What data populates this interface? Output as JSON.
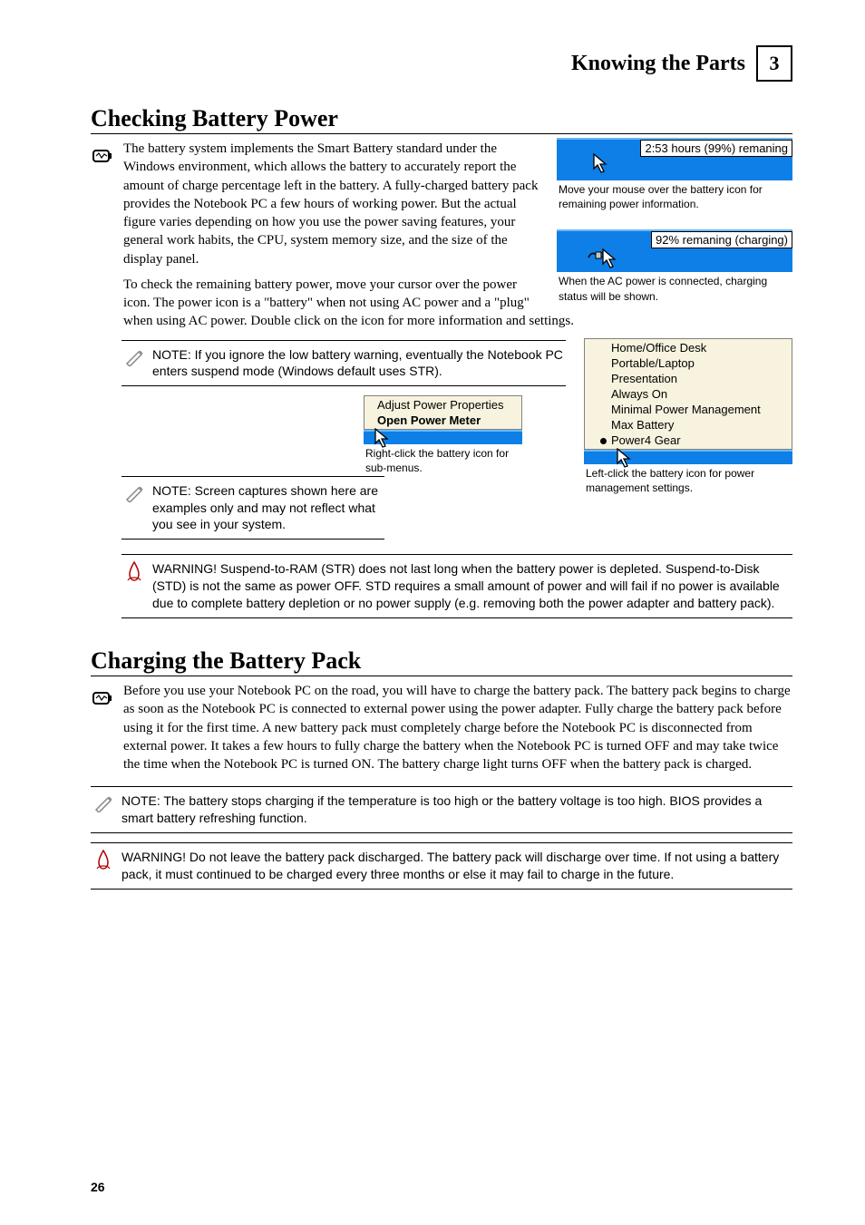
{
  "header": {
    "title": "Knowing the Parts",
    "num": "3"
  },
  "section1_title": "Checking Battery Power",
  "icon1_glyph": "~",
  "body1": "The battery system implements the Smart Battery standard under the Windows environment, which allows the battery to accurately report the amount of charge percentage left in the battery. A fully-charged battery pack provides the Notebook PC a few hours of working power. But the actual figure varies depending on how you use the power saving features, your general work habits, the CPU, system memory size, and the size of the display panel.",
  "body1_tail": "To check the remaining battery power, move your cursor over the power icon. The power icon is a \"battery\" when not using AC power and a \"plug\" when using AC power. Double click on the icon for more information and settings.",
  "tooltip1": "2:53 hours (99%) remaning",
  "cap1": "Move your mouse over the battery icon for remaining power information.",
  "tooltip2": "92% remaning (charging)",
  "cap2": "When the AC power is connected, charging status will be shown.",
  "note1": "NOTE: If you ignore the low battery warning, eventually the Notebook PC enters suspend mode (Windows default uses STR).",
  "note2": "NOTE: Screen captures shown here are examples only and may not reflect what you see in your system.",
  "menu1": {
    "items": [
      "Adjust Power Properties",
      "Open Power Meter"
    ]
  },
  "cap3": "Right-click the battery icon for sub-menus.",
  "menu2": {
    "items": [
      "Home/Office Desk",
      "Portable/Laptop",
      "Presentation",
      "Always On",
      "Minimal Power Management",
      "Max Battery",
      "Power4 Gear"
    ],
    "selected_index": 6
  },
  "cap4": "Left-click the battery icon for power management settings.",
  "warn1": "WARNING! Suspend-to-RAM (STR) does not last long when the battery power is depleted. Suspend-to-Disk (STD) is not the same as power OFF. STD requires a small amount of power and will fail if no power is available due to complete battery depletion or no power supply (e.g. removing both the power adapter and battery pack).",
  "section2_title": "Charging the Battery Pack",
  "icon2_glyph": "~",
  "body2": "Before you use your Notebook PC on the road, you will have to charge the battery pack. The battery pack begins to charge as soon as the Notebook PC is connected to external power using the power adapter. Fully charge the battery pack before using it for the first time. A new battery pack must completely charge before the Notebook PC is disconnected from external power. It takes a few hours to fully charge the battery when the Notebook PC is turned OFF and may take twice the time when the Notebook PC is turned ON. The battery charge light turns OFF when the battery pack is charged.",
  "note3": "NOTE: The battery stops charging if the temperature is too high or the battery voltage is too high. BIOS provides a smart battery refreshing function.",
  "warn2": "WARNING! Do not leave the battery pack discharged. The battery pack will discharge over time. If not using a battery pack, it must continued to be charged every three months or else it may fail to charge in the future.",
  "footer": "26"
}
